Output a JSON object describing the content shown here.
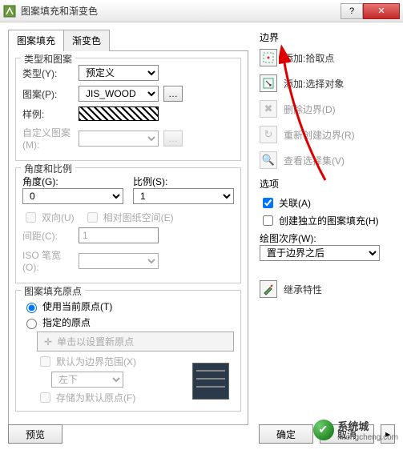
{
  "window": {
    "title": "图案填充和渐变色"
  },
  "tabs": {
    "fill": "图案填充",
    "grad": "渐变色"
  },
  "type_group": {
    "title": "类型和图案",
    "type_label": "类型(Y):",
    "type_value": "预定义",
    "pattern_label": "图案(P):",
    "pattern_value": "JIS_WOOD",
    "sample_label": "样例:",
    "custom_label": "自定义图案(M):"
  },
  "angle_group": {
    "title": "角度和比例",
    "angle_label": "角度(G):",
    "angle_value": "0",
    "scale_label": "比例(S):",
    "scale_value": "1",
    "bidir": "双向(U)",
    "paper": "相对图纸空间(E)",
    "spacing_label": "间距(C):",
    "spacing_value": "1",
    "iso_label": "ISO 笔宽(O):"
  },
  "origin_group": {
    "title": "图案填充原点",
    "use_current": "使用当前原点(T)",
    "specified": "指定的原点",
    "set_new": "单击以设置新原点",
    "default_bound": "默认为边界范围(X)",
    "corner_value": "左下",
    "store": "存储为默认原点(F)"
  },
  "boundary": {
    "title": "边界",
    "add_pick": "添加:拾取点",
    "add_select": "添加:选择对象",
    "remove": "删除边界(D)",
    "recreate": "重新创建边界(R)",
    "view_sel": "查看选择集(V)"
  },
  "options": {
    "title": "选项",
    "assoc": "关联(A)",
    "independent": "创建独立的图案填充(H)",
    "draw_order_label": "绘图次序(W):",
    "draw_order_value": "置于边界之后"
  },
  "inherit": {
    "label": "继承特性"
  },
  "footer": {
    "preview": "预览",
    "ok": "确定",
    "cancel": "取消"
  },
  "watermark": {
    "line1": "系统城",
    "line2": "xitongcheng.com"
  }
}
